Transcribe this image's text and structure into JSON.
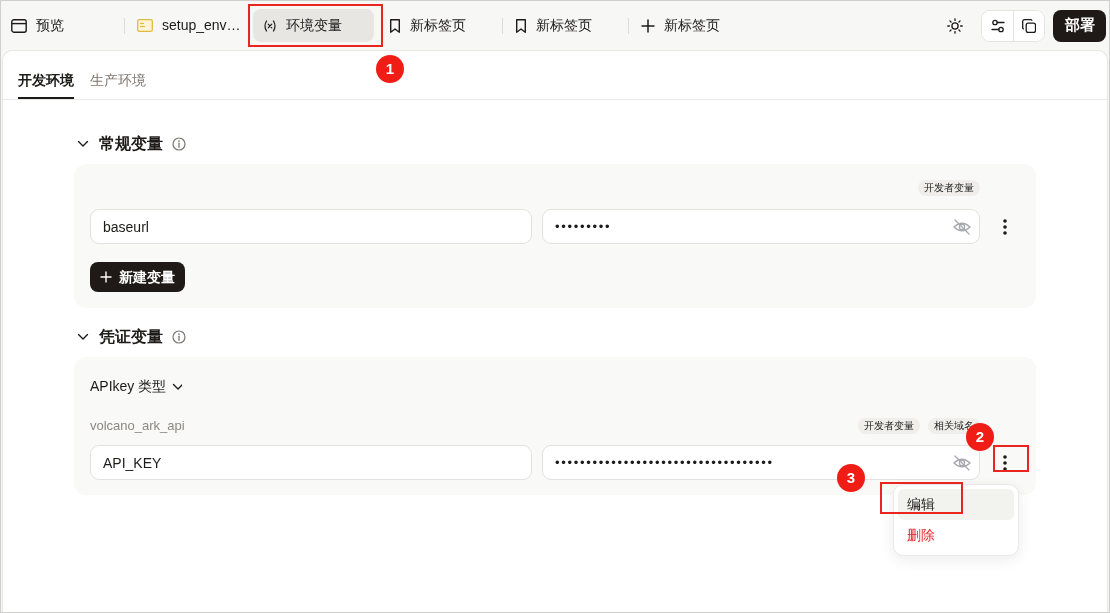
{
  "top_tabs": [
    {
      "kind": "preview",
      "label": "预览",
      "selected": false
    },
    {
      "kind": "terminal",
      "label": "setup_env…",
      "selected": false
    },
    {
      "kind": "variable",
      "label": "环境变量",
      "selected": true,
      "callout": "1"
    },
    {
      "kind": "bookmark",
      "label": "新标签页",
      "selected": false
    },
    {
      "kind": "bookmark",
      "label": "新标签页",
      "selected": false
    },
    {
      "kind": "new",
      "label": "新标签页",
      "selected": false
    }
  ],
  "toolbar": {
    "deploy_button": "部署"
  },
  "env_tabs": [
    {
      "label": "开发环境",
      "selected": true
    },
    {
      "label": "生产环境",
      "selected": false
    }
  ],
  "sections": [
    {
      "kind": "plain",
      "title": "常规变量",
      "expanded": true,
      "rows": [
        {
          "tags": [
            "开发者变量"
          ],
          "name": "baseurl",
          "value": "•••••••••",
          "masked": true
        }
      ],
      "add_button": "新建变量"
    },
    {
      "kind": "credential",
      "title": "凭证变量",
      "expanded": true,
      "type_selector": "APIkey 类型",
      "rows": [
        {
          "label": "volcano_ark_api",
          "tags": [
            "开发者变量",
            "相关域名"
          ],
          "name": "API_KEY",
          "value": "•••••••••••••••••••••••••••••••••••",
          "masked": true,
          "more_button": {
            "callout": "2"
          },
          "menu": {
            "items": [
              {
                "label": "编辑",
                "kind": "normal",
                "selected": true,
                "callout": "3"
              },
              {
                "label": "删除",
                "kind": "danger",
                "selected": false
              }
            ]
          }
        }
      ]
    }
  ]
}
